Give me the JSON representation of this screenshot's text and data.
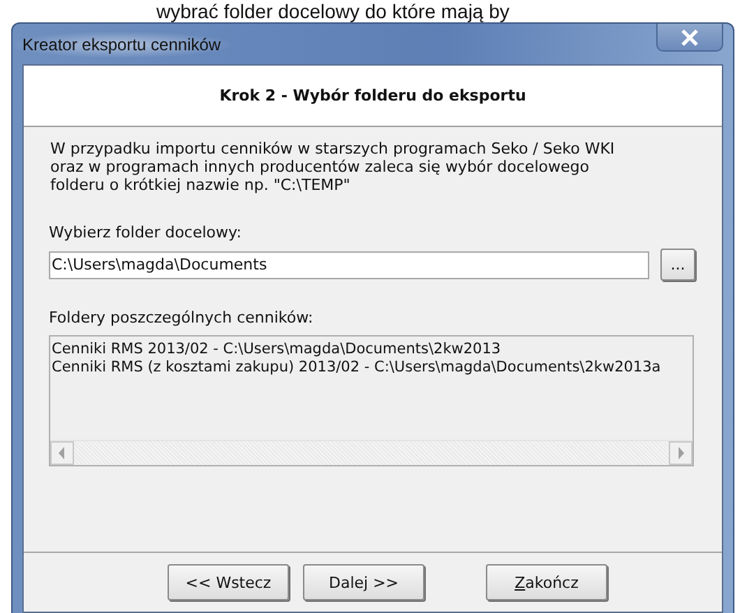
{
  "background_text": "wybrać folder docelowy do które mają by",
  "window": {
    "title": "Kreator eksportu cenników"
  },
  "header": {
    "title": "Krok 2 - Wybór folderu do eksportu"
  },
  "description": [
    "W przypadku importu cenników w starszych programach Seko / Seko WKI",
    "oraz w programach innych producentów zaleca się wybór docelowego",
    "folderu o krótkiej nazwie np. \"C:\\TEMP\""
  ],
  "folder_field": {
    "label": "Wybierz folder docelowy:",
    "value": "C:\\Users\\magda\\Documents",
    "browse_button": "..."
  },
  "folders_list": {
    "label": "Foldery poszczególnych cenników:",
    "items": [
      "Cenniki RMS 2013/02 - C:\\Users\\magda\\Documents\\2kw2013",
      "Cenniki RMS (z kosztami zakupu) 2013/02 - C:\\Users\\magda\\Documents\\2kw2013a"
    ]
  },
  "buttons": [
    {
      "label": "<< Wstecz",
      "kind": "back",
      "first_letter_underlined": false
    },
    {
      "label": "Dalej >>",
      "kind": "next",
      "first_letter_underlined": false
    },
    {
      "label": "Zakończ",
      "kind": "finish",
      "first_letter_underlined": true
    }
  ]
}
